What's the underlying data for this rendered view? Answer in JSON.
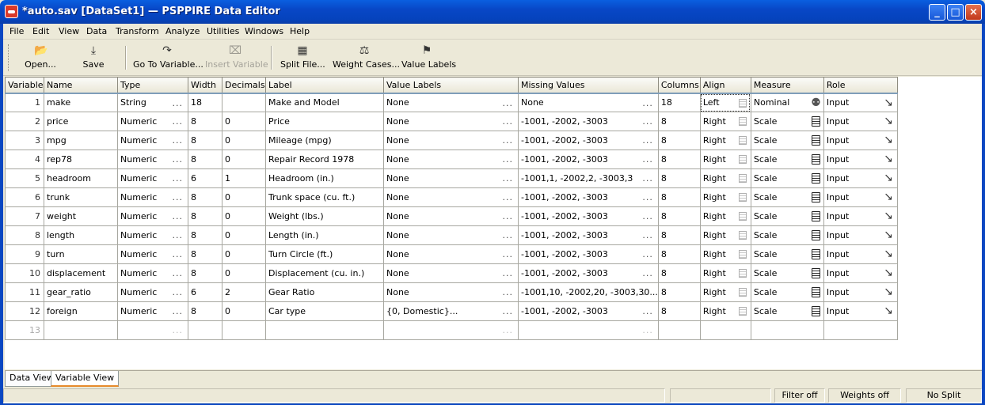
{
  "window": {
    "title": "*auto.sav [DataSet1] — PSPPIRE Data Editor",
    "minimize": "_",
    "maximize": "□",
    "close": "×"
  },
  "menu": [
    "File",
    "Edit",
    "View",
    "Data",
    "Transform",
    "Analyze",
    "Utilities",
    "Windows",
    "Help"
  ],
  "toolbar": {
    "open": "Open...",
    "save": "Save",
    "goto_variable": "Go To Variable...",
    "insert_variable": "Insert Variable",
    "split_file": "Split File...",
    "weight_cases": "Weight Cases...",
    "value_labels": "Value Labels"
  },
  "icons": {
    "open": "open-folder-icon",
    "save": "save-down-arrow-icon",
    "goto": "goto-variable-icon",
    "insert": "insert-variable-icon",
    "split": "split-file-grid-icon",
    "weight": "scales-icon",
    "value_labels": "value-label-tag-icon"
  },
  "columns": [
    "Variable",
    "Name",
    "Type",
    "Width",
    "Decimals",
    "Label",
    "Value Labels",
    "Missing Values",
    "Columns",
    "Align",
    "Measure",
    "Role"
  ],
  "rows": [
    {
      "n": "1",
      "name": "make",
      "type": "String",
      "width": "18",
      "decimals": "",
      "label": "Make and Model",
      "values": "None",
      "missing": "None",
      "columns": "18",
      "align": "Left",
      "measure": "Nominal",
      "role": "Input"
    },
    {
      "n": "2",
      "name": "price",
      "type": "Numeric",
      "width": "8",
      "decimals": "0",
      "label": "Price",
      "values": "None",
      "missing": "-1001, -2002, -3003",
      "columns": "8",
      "align": "Right",
      "measure": "Scale",
      "role": "Input"
    },
    {
      "n": "3",
      "name": "mpg",
      "type": "Numeric",
      "width": "8",
      "decimals": "0",
      "label": "Mileage (mpg)",
      "values": "None",
      "missing": "-1001, -2002, -3003",
      "columns": "8",
      "align": "Right",
      "measure": "Scale",
      "role": "Input"
    },
    {
      "n": "4",
      "name": "rep78",
      "type": "Numeric",
      "width": "8",
      "decimals": "0",
      "label": "Repair Record 1978",
      "values": "None",
      "missing": "-1001, -2002, -3003",
      "columns": "8",
      "align": "Right",
      "measure": "Scale",
      "role": "Input"
    },
    {
      "n": "5",
      "name": "headroom",
      "type": "Numeric",
      "width": "6",
      "decimals": "1",
      "label": "Headroom (in.)",
      "values": "None",
      "missing": "-1001,1, -2002,2, -3003,3",
      "columns": "8",
      "align": "Right",
      "measure": "Scale",
      "role": "Input"
    },
    {
      "n": "6",
      "name": "trunk",
      "type": "Numeric",
      "width": "8",
      "decimals": "0",
      "label": "Trunk space (cu. ft.)",
      "values": "None",
      "missing": "-1001, -2002, -3003",
      "columns": "8",
      "align": "Right",
      "measure": "Scale",
      "role": "Input"
    },
    {
      "n": "7",
      "name": "weight",
      "type": "Numeric",
      "width": "8",
      "decimals": "0",
      "label": "Weight (lbs.)",
      "values": "None",
      "missing": "-1001, -2002, -3003",
      "columns": "8",
      "align": "Right",
      "measure": "Scale",
      "role": "Input"
    },
    {
      "n": "8",
      "name": "length",
      "type": "Numeric",
      "width": "8",
      "decimals": "0",
      "label": "Length (in.)",
      "values": "None",
      "missing": "-1001, -2002, -3003",
      "columns": "8",
      "align": "Right",
      "measure": "Scale",
      "role": "Input"
    },
    {
      "n": "9",
      "name": "turn",
      "type": "Numeric",
      "width": "8",
      "decimals": "0",
      "label": "Turn Circle (ft.)",
      "values": "None",
      "missing": "-1001, -2002, -3003",
      "columns": "8",
      "align": "Right",
      "measure": "Scale",
      "role": "Input"
    },
    {
      "n": "10",
      "name": "displacement",
      "type": "Numeric",
      "width": "8",
      "decimals": "0",
      "label": "Displacement (cu. in.)",
      "values": "None",
      "missing": "-1001, -2002, -3003",
      "columns": "8",
      "align": "Right",
      "measure": "Scale",
      "role": "Input"
    },
    {
      "n": "11",
      "name": "gear_ratio",
      "type": "Numeric",
      "width": "6",
      "decimals": "2",
      "label": "Gear Ratio",
      "values": "None",
      "missing": "-1001,10, -2002,20, -3003,30...",
      "columns": "8",
      "align": "Right",
      "measure": "Scale",
      "role": "Input"
    },
    {
      "n": "12",
      "name": "foreign",
      "type": "Numeric",
      "width": "8",
      "decimals": "0",
      "label": "Car type",
      "values": "{0, Domestic}...",
      "missing": "-1001, -2002, -3003",
      "columns": "8",
      "align": "Right",
      "measure": "Scale",
      "role": "Input"
    }
  ],
  "empty_row": {
    "n": "13",
    "dots": "..."
  },
  "cell_dots": "...",
  "tabs": [
    "Data View",
    "Variable View"
  ],
  "status": {
    "filter": "Filter off",
    "weights": "Weights off",
    "split": "No Split"
  }
}
